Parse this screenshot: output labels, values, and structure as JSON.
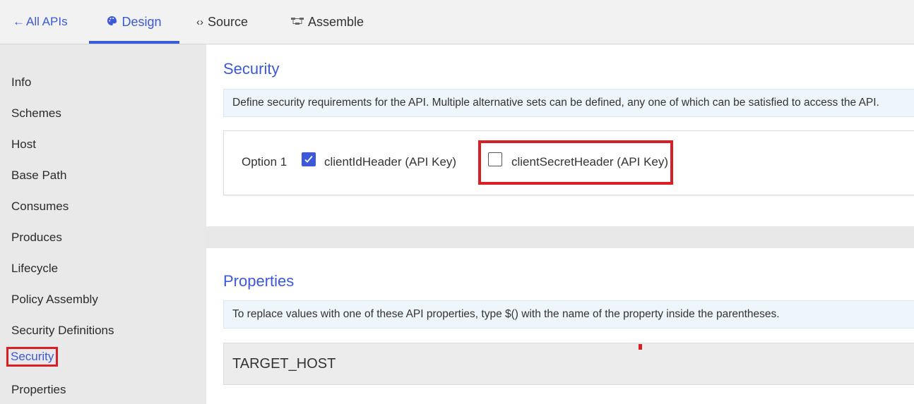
{
  "nav": {
    "back_label": "All APIs",
    "tabs": [
      {
        "label": "Design",
        "icon": "palette-icon",
        "active": true
      },
      {
        "label": "Source",
        "icon": "code-icon",
        "active": false
      },
      {
        "label": "Assemble",
        "icon": "flow-icon",
        "active": false
      }
    ]
  },
  "sidebar": {
    "items": [
      {
        "label": "Info"
      },
      {
        "label": "Schemes"
      },
      {
        "label": "Host"
      },
      {
        "label": "Base Path"
      },
      {
        "label": "Consumes"
      },
      {
        "label": "Produces"
      },
      {
        "label": "Lifecycle"
      },
      {
        "label": "Policy Assembly"
      },
      {
        "label": "Security Definitions"
      },
      {
        "label": "Security",
        "active": true
      },
      {
        "label": "Properties"
      }
    ]
  },
  "security": {
    "title": "Security",
    "description": "Define security requirements for the API. Multiple alternative sets can be defined, any one of which can be satisfied to access the API.",
    "option_label": "Option 1",
    "options": [
      {
        "label": "clientIdHeader (API Key)",
        "checked": true
      },
      {
        "label": "clientSecretHeader (API Key)",
        "checked": false
      }
    ]
  },
  "properties": {
    "title": "Properties",
    "description": "To replace values with one of these API properties, type $() with the name of the property inside the parentheses.",
    "items": [
      {
        "name": "TARGET_HOST"
      }
    ]
  },
  "colors": {
    "accent": "#3b59d9",
    "highlight": "#d91f26",
    "info_bg": "#eef5fb"
  }
}
